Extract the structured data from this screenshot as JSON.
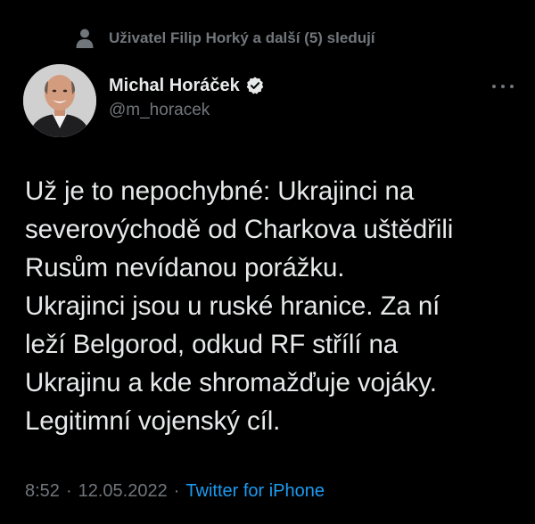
{
  "social_context": {
    "text": "Uživatel Filip Horký a další (5) sledují"
  },
  "author": {
    "name": "Michal Horáček",
    "handle": "@m_horacek",
    "verified": true
  },
  "tweet": {
    "lines": [
      "Už je to nepochybné: Ukrajinci na",
      "severovýchodě od Charkova uštědřili",
      "Rusům nevídanou porážku.",
      "Ukrajinci jsou u ruské hranice. Za ní",
      "leží Belgorod, odkud RF střílí na",
      "Ukrajinu a kde shromažďuje vojáky.",
      "Legitimní vojenský cíl."
    ]
  },
  "meta": {
    "time": "8:52",
    "separator": "·",
    "date": "12.05.2022",
    "source": "Twitter for iPhone"
  },
  "icons": {
    "social_context": "person-icon",
    "verified": "verified-badge-icon",
    "more": "more-options-icon"
  },
  "colors": {
    "background": "#000000",
    "text_primary": "#e7e9ea",
    "text_secondary": "#71767b",
    "accent": "#1d9bf0"
  }
}
